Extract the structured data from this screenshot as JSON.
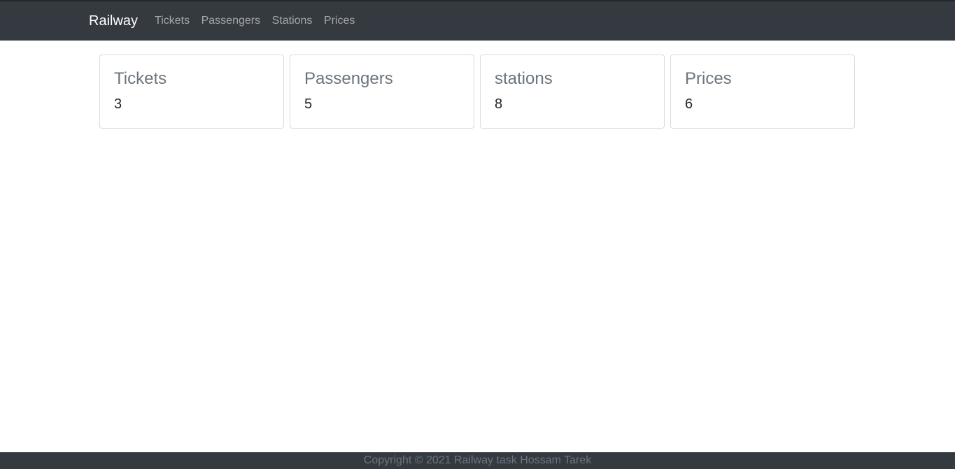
{
  "navbar": {
    "brand": "Railway",
    "links": [
      "Tickets",
      "Passengers",
      "Stations",
      "Prices"
    ]
  },
  "cards": [
    {
      "title": "Tickets",
      "value": "3"
    },
    {
      "title": "Passengers",
      "value": "5"
    },
    {
      "title": "stations",
      "value": "8"
    },
    {
      "title": "Prices",
      "value": "6"
    }
  ],
  "footer": {
    "text": "Copyright © 2021 Railway task Hossam Tarek"
  },
  "colors": {
    "navbar_bg": "#343a40",
    "footer_bg": "#343a40",
    "card_title": "#6c757d"
  }
}
